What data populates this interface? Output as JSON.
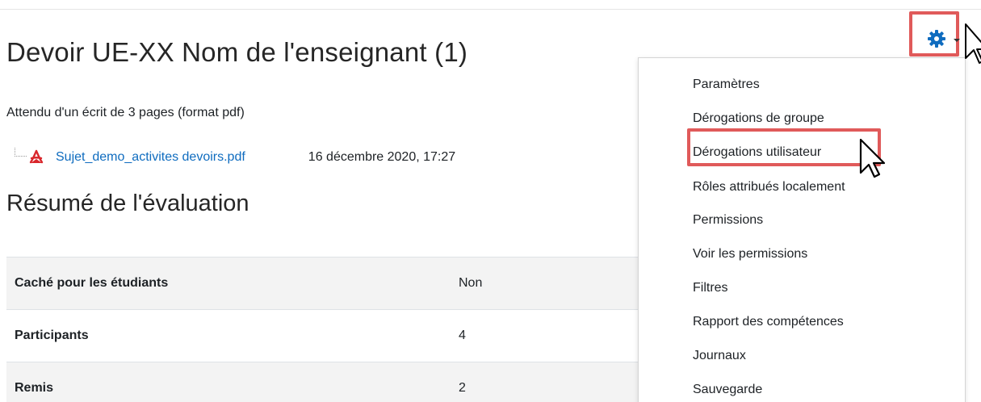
{
  "page": {
    "title": "Devoir UE-XX Nom de l'enseignant (1)",
    "intro": "Attendu d'un écrit de 3 pages (format pdf)"
  },
  "attachment": {
    "file_name": "Sujet_demo_activites devoirs.pdf",
    "date": "16 décembre 2020, 17:27",
    "icon": "pdf-icon"
  },
  "summary": {
    "title": "Résumé de l'évaluation",
    "rows": [
      {
        "label": "Caché pour les étudiants",
        "value": "Non"
      },
      {
        "label": "Participants",
        "value": "4"
      },
      {
        "label": "Remis",
        "value": "2"
      }
    ]
  },
  "actions_menu": {
    "icon": "gear-icon",
    "items": [
      "Paramètres",
      "Dérogations de groupe",
      "Dérogations utilisateur",
      "Rôles attribués localement",
      "Permissions",
      "Voir les permissions",
      "Filtres",
      "Rapport des compétences",
      "Journaux",
      "Sauvegarde"
    ],
    "highlighted_item": "Dérogations utilisateur"
  },
  "colors": {
    "accent_blue": "#0f6cbf",
    "highlight_red": "#e05a5a",
    "pdf_red": "#d9262b"
  }
}
